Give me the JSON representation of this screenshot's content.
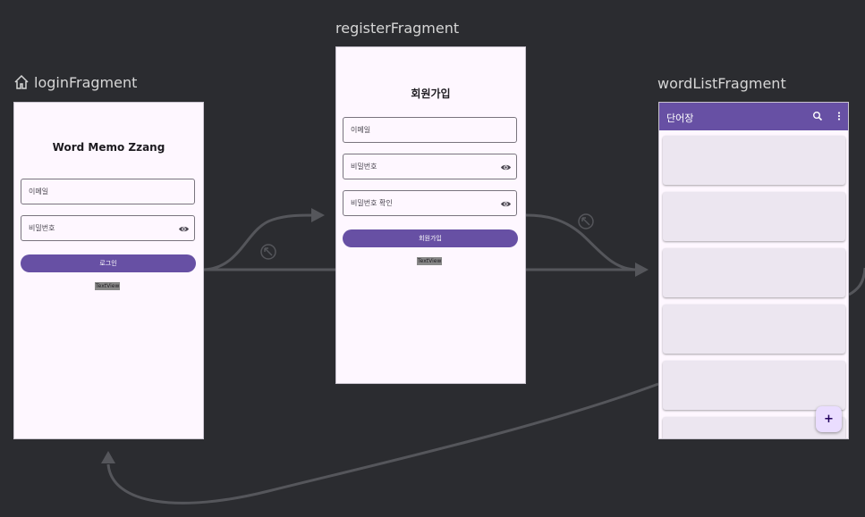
{
  "fragments": {
    "login": {
      "title": "loginFragment",
      "heading": "Word Memo Zzang",
      "email_placeholder": "이메일",
      "password_placeholder": "비밀번호",
      "login_button": "로그인",
      "textview": "TextView"
    },
    "register": {
      "title": "registerFragment",
      "heading": "회원가입",
      "email_placeholder": "이메일",
      "password_placeholder": "비밀번호",
      "password_confirm_placeholder": "비밀번호 확인",
      "register_button": "회원가입",
      "textview": "TextView"
    },
    "wordlist": {
      "title": "wordListFragment",
      "appbar_title": "단어장",
      "fab_label": "+",
      "card_count": 6
    }
  },
  "icons": [
    "home-icon",
    "visibility-icon",
    "search-icon",
    "more-vert-icon",
    "add-icon",
    "action-link-icon"
  ],
  "colors": {
    "canvas_bg": "#2b2c30",
    "arrow": "#55565b",
    "primary": "#6750a4",
    "screen_bg": "#fef7ff",
    "card_bg": "#ece6f0",
    "fab_bg": "#eaddff"
  }
}
